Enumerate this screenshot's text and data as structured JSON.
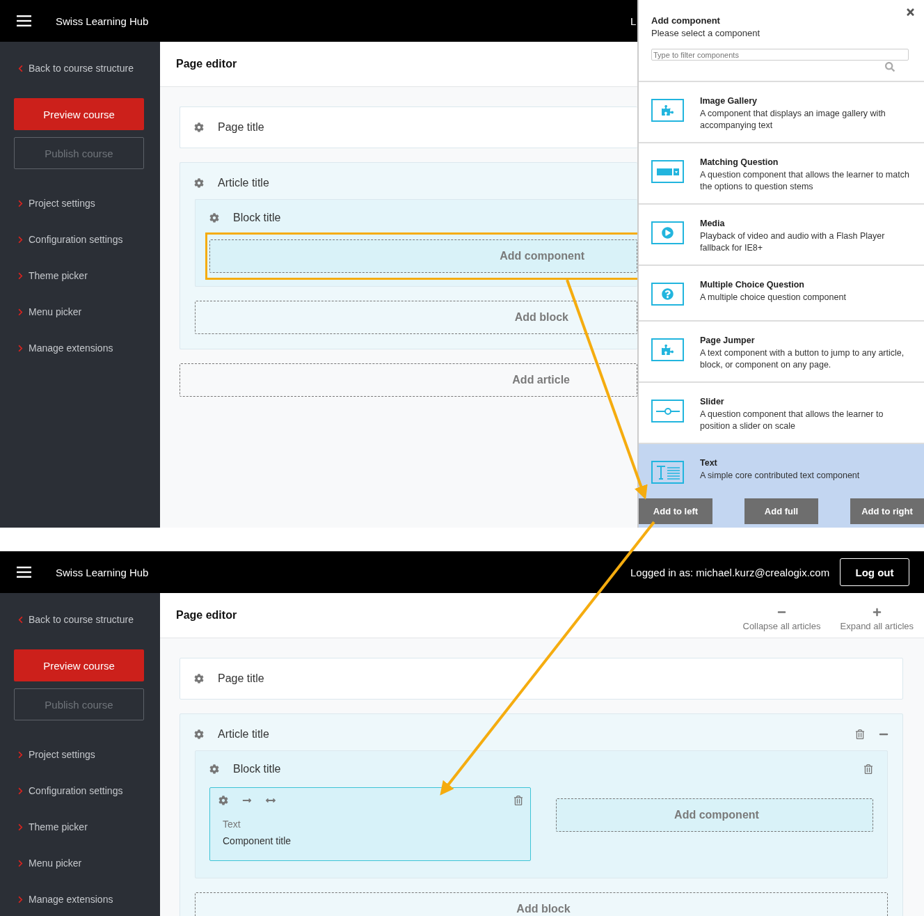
{
  "screens": [
    {
      "header": {
        "brand": "Swiss Learning Hub",
        "user_text": "L"
      },
      "sidebar": {
        "back": "Back to course structure",
        "preview": "Preview course",
        "publish": "Publish course",
        "items": [
          "Project settings",
          "Configuration settings",
          "Theme picker",
          "Menu picker",
          "Manage extensions"
        ]
      },
      "editor": {
        "title": "Page editor",
        "page_title": "Page title",
        "articles": [
          {
            "title": "Article title",
            "blocks": [
              {
                "title": "Block title",
                "add_component": "Add component",
                "highlighted": true
              }
            ],
            "add_block": "Add block"
          }
        ],
        "add_article": "Add article"
      },
      "panel": {
        "title": "Add component",
        "subtitle": "Please select a component",
        "placeholder": "Type to filter components",
        "items": [
          {
            "kind": "gallery",
            "name": "Image Gallery",
            "description": "A component that displays an image gallery with accompanying text",
            "selected": false
          },
          {
            "kind": "matching",
            "name": "Matching Question",
            "description": "A question component that allows the learner to match the options to question stems",
            "selected": false
          },
          {
            "kind": "media",
            "name": "Media",
            "description": "Playback of video and audio with a Flash Player fallback for IE8+",
            "selected": false
          },
          {
            "kind": "question",
            "name": "Multiple Choice Question",
            "description": "A multiple choice question component",
            "selected": false
          },
          {
            "kind": "gallery",
            "name": "Page Jumper",
            "description": "A text component with a button to jump to any article, block, or component on any page.",
            "selected": false
          },
          {
            "kind": "slider",
            "name": "Slider",
            "description": "A question component that allows the learner to position a slider on scale",
            "selected": false
          },
          {
            "kind": "text",
            "name": "Text",
            "description": "A simple core contributed text component",
            "selected": true
          }
        ],
        "buttons": [
          "Add to left",
          "Add full",
          "Add to right"
        ]
      }
    },
    {
      "header": {
        "brand": "Swiss Learning Hub",
        "user_text": "Logged in as: michael.kurz@crealogix.com",
        "logout": "Log out"
      },
      "sidebar": {
        "back": "Back to course structure",
        "preview": "Preview course",
        "publish": "Publish course",
        "items": [
          "Project settings",
          "Configuration settings",
          "Theme picker",
          "Menu picker",
          "Manage extensions"
        ]
      },
      "editor": {
        "title": "Page editor",
        "actions": [
          {
            "kind": "collapse",
            "label": "Collapse all articles"
          },
          {
            "kind": "expand",
            "label": "Expand all articles"
          }
        ],
        "page_title": "Page title",
        "articles": [
          {
            "title": "Article title",
            "blocks": [
              {
                "title": "Block title",
                "components": [
                  {
                    "type": "Text",
                    "title": "Component title"
                  }
                ],
                "add_component": "Add component"
              }
            ],
            "add_block": "Add block"
          }
        ]
      }
    }
  ]
}
